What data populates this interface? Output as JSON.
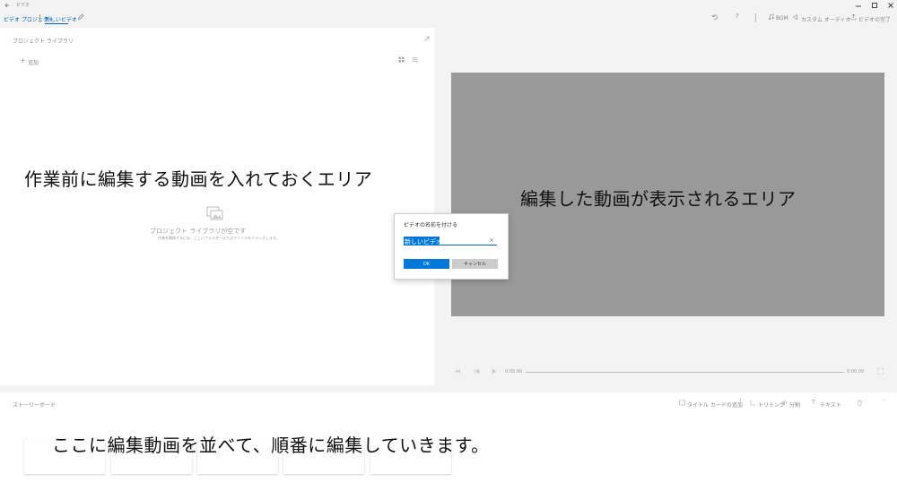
{
  "window": {
    "title": "ビデオ",
    "minimize_icon": "minimize-icon",
    "maximize_icon": "maximize-icon",
    "close_icon": "close-icon"
  },
  "nav": {
    "back_label": "ビデオ プロジェクト",
    "project_name": "新しいビデオ",
    "edit_icon": "pencil-icon"
  },
  "toolbar": {
    "undo_icon": "undo-icon",
    "help_icon": "help-icon",
    "bgm_label": "BGM",
    "custom_audio_label": "カスタム オーディオ",
    "finish_label": "ビデオの完了",
    "more_icon": "more-icon"
  },
  "library": {
    "title": "プロジェクト ライブラリ",
    "add_label": "追加",
    "empty_title": "プロジェクト ライブラリが空です",
    "empty_hint": "作業を開始するには、ここにフォルダーまたはファイルをドラッグします。"
  },
  "preview": {
    "time_current": "0:00.00",
    "time_total": "0:00.00"
  },
  "storyboard": {
    "title": "ストーリーボード",
    "add_title_card": "タイトル カードの追加",
    "trim_label": "トリミング",
    "split_label": "分割",
    "text_label": "テキスト"
  },
  "dialog": {
    "title": "ビデオの名前を付ける",
    "input_value": "新しいビデオ",
    "ok_label": "OK",
    "cancel_label": "キャンセル"
  },
  "annotations": {
    "library_note": "作業前に編集する動画を入れておくエリア",
    "preview_note": "編集した動画が表示されるエリア",
    "storyboard_note": "ここに編集動画を並べて、順番に編集していきます。"
  }
}
